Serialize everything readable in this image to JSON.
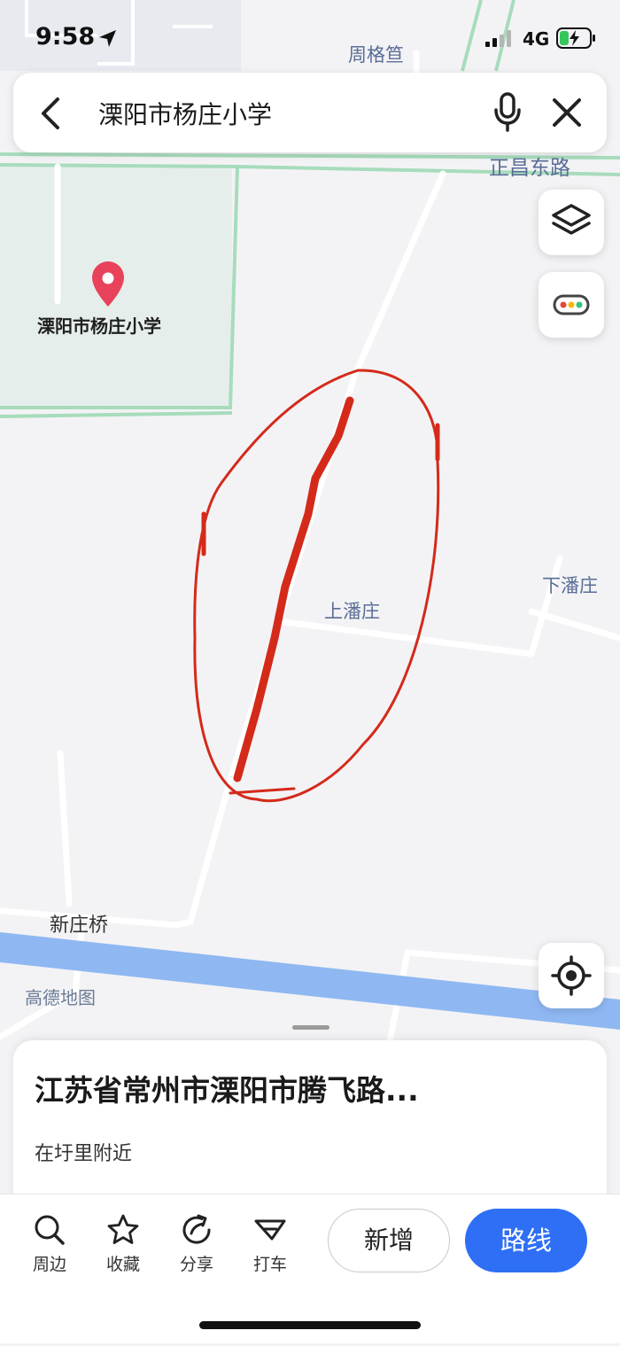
{
  "status_bar": {
    "time": "9:58",
    "network": "4G"
  },
  "search": {
    "query": "溧阳市杨庄小学"
  },
  "map": {
    "poi": {
      "name": "溧阳市杨庄小学"
    },
    "labels": {
      "zhougegua": "周格笪",
      "zhengchang_road": "正昌东路",
      "shangpanzhuang": "上潘庄",
      "xiapanzhuang": "下潘庄",
      "xinzhuangqiao": "新庄桥"
    },
    "watermark": "高德地图",
    "colors": {
      "annotation": "#d42a1a",
      "water": "#8fb8f2",
      "accent": "#2f6ff5",
      "poi": "#e8435a"
    }
  },
  "place_card": {
    "address": "江苏省常州市溧阳市腾飞路...",
    "subtitle": "在圩里附近"
  },
  "toolbar": {
    "nearby": "周边",
    "favorite": "收藏",
    "share": "分享",
    "taxi": "打车",
    "add": "新增",
    "route": "路线"
  },
  "icons": [
    "location-arrow-icon",
    "signal-icon",
    "battery-charging-icon",
    "back-chevron-icon",
    "microphone-icon",
    "close-icon",
    "layers-icon",
    "traffic-icon",
    "locate-me-icon",
    "search-icon",
    "star-icon",
    "share-icon",
    "taxi-icon",
    "poi-pin-icon"
  ]
}
